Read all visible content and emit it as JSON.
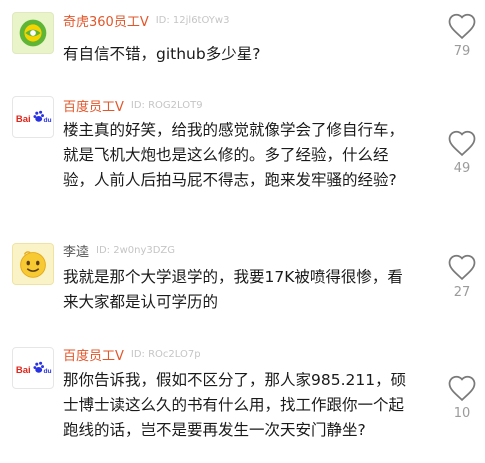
{
  "comments": [
    {
      "author": "奇虎360员工V",
      "uid": "ID: 12jl6tOYw3",
      "text": "有自信不错，github多少星?",
      "likes": "79",
      "avatar_icon": "qihoo-360-logo"
    },
    {
      "author": "百度员工V",
      "uid": "ID: ROG2LOT9",
      "text": "楼主真的好笑，给我的感觉就像学会了修自行车，就是飞机大炮也是这么修的。多了经验，什么经验，人前人后拍马屁不得志，跑来发牢骚的经验?",
      "likes": "49",
      "avatar_icon": "baidu-logo"
    },
    {
      "author": "李逵",
      "uid": "ID: 2w0ny3DZG",
      "text": "我就是那个大学退学的，我要17K被喷得很惨，看来大家都是认可学历的",
      "likes": "27",
      "avatar_icon": "smiley-face"
    },
    {
      "author": "百度员工V",
      "uid": "ID: ROc2LO7p",
      "text": "那你告诉我，假如不区分了，那人家985.211，硕士博士读这么久的书有什么用，找工作跟你一个起跑线的话，岂不是要再发生一次天安门静坐?",
      "likes": "10",
      "avatar_icon": "baidu-logo"
    }
  ],
  "colors": {
    "employee_name": "#e3562a",
    "like_count": "#9b9b9b"
  }
}
